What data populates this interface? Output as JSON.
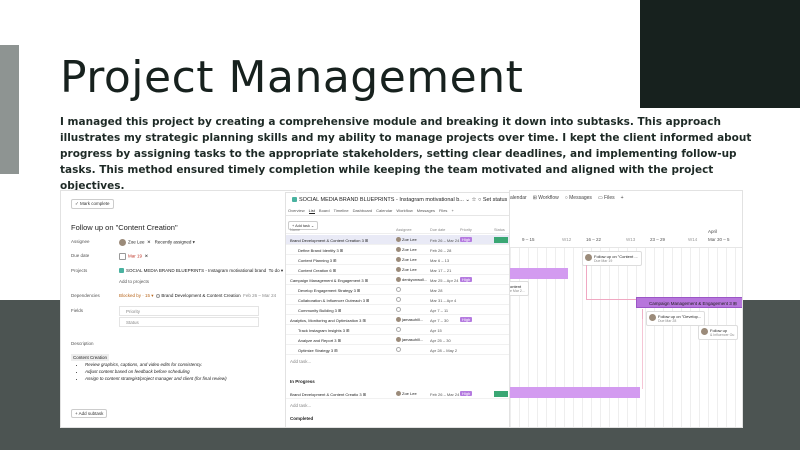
{
  "page": {
    "title": "Project Management",
    "description": "I managed this project by creating a comprehensive module and breaking it down into subtasks. This approach illustrates my strategic planning skills and my ability to manage projects over time. I kept the client informed about progress by assigning tasks to the appropriate stakeholders, setting clear deadlines, and implementing follow-up tasks. This method ensured timely completion while keeping the team motivated and aligned with the project objectives."
  },
  "task_detail": {
    "mark_complete": "✓ Mark complete",
    "title": "Follow up on \"Content Creation\"",
    "assignee_label": "Assignee",
    "assignee": "Zoe Lee",
    "assignee_remove": "✕",
    "assignee_note": "Recently assigned ▾",
    "due_label": "Due date",
    "due": "Mar 19",
    "due_remove": "✕",
    "projects_label": "Projects",
    "project": "SOCIAL MEDIA BRAND BLUEPRINTS - Instagram motivational brand",
    "project_status": "To do ▾",
    "add_projects": "Add to projects",
    "dependencies_label": "Dependencies",
    "blocked_by": "Blocked by · 15 ▾",
    "dependency": "Brand Development & Content Creation",
    "dependency_dates": "Feb 26 – Mar 24",
    "fields_label": "Fields",
    "field_priority": "Priority",
    "field_status": "Status",
    "description_label": "Description",
    "description_tag": "Content Creation",
    "bullets": [
      "Review graphics, captions, and video edits for consistency.",
      "Adjust content based on feedback before scheduling",
      "Assign to content strategist/project manager and client (for final review)"
    ],
    "add_subtask": "+ Add subtask"
  },
  "list_view": {
    "project_title": "SOCIAL MEDIA BRAND BLUEPRINTS - Instagram motivational b... ⌄ ☆ ○ Set status",
    "tabs": [
      "Overview",
      "List",
      "Board",
      "Timeline",
      "Dashboard",
      "Calendar",
      "Workflow",
      "Messages",
      "Files",
      "+"
    ],
    "active_tab": "List",
    "add_task": "+ Add task  ⌄",
    "columns": [
      "Name",
      "Assignee",
      "Due date",
      "Priority",
      "Status"
    ],
    "rows": [
      {
        "name": "Brand Development & Content Creation  3 ⊞",
        "assignee": "Zoe Lee",
        "due": "Feb 26 – Mar 24",
        "priority": "High",
        "status": true,
        "indent": 0,
        "hl": true
      },
      {
        "name": "Define Brand Identity  3 ⊞",
        "assignee": "Zoe Lee",
        "due": "Feb 26 – 28",
        "priority": "",
        "status": false,
        "indent": 1,
        "hl": false
      },
      {
        "name": "Content Planning  3 ⊞",
        "assignee": "Zoe Lee",
        "due": "Mar 6 – 13",
        "priority": "",
        "status": false,
        "indent": 1,
        "hl": false
      },
      {
        "name": "Content Creation  6 ⊞",
        "assignee": "Zoe Lee",
        "due": "Mar 17 – 21",
        "priority": "",
        "status": false,
        "indent": 1,
        "hl": false
      },
      {
        "name": "Campaign Management & Engagement  3 ⊞",
        "assignee": "denkyonwoll...",
        "due": "Mar 25 – Apr 24",
        "priority": "High",
        "status": false,
        "indent": 0,
        "hl": false
      },
      {
        "name": "Develop Engagement Strategy  3 ⊞",
        "assignee": "",
        "due": "Mar 28",
        "priority": "",
        "status": false,
        "indent": 1,
        "hl": false
      },
      {
        "name": "Collaboration & Influencer Outreach  3 ⊞",
        "assignee": "",
        "due": "Mar 31 – Apr 4",
        "priority": "",
        "status": false,
        "indent": 1,
        "hl": false
      },
      {
        "name": "Community Building  3 ⊞",
        "assignee": "",
        "due": "Apr 7 – 11",
        "priority": "",
        "status": false,
        "indent": 1,
        "hl": false
      },
      {
        "name": "Analytics, Monitoring and Optimization  3 ⊞",
        "assignee": "jamasuhill...",
        "due": "Apr 7 – 30",
        "priority": "High",
        "status": false,
        "indent": 0,
        "hl": false
      },
      {
        "name": "Track Instagram Insights  3 ⊞",
        "assignee": "",
        "due": "Apr 15",
        "priority": "",
        "status": false,
        "indent": 1,
        "hl": false
      },
      {
        "name": "Analyze and Report  3 ⊞",
        "assignee": "jamasuhill...",
        "due": "Apr 25 – 30",
        "priority": "",
        "status": false,
        "indent": 1,
        "hl": false
      },
      {
        "name": "Optimize Strategy  3 ⊞",
        "assignee": "",
        "due": "Apr 28 – May 2",
        "priority": "",
        "status": false,
        "indent": 1,
        "hl": false
      }
    ],
    "add_task_link": "Add task...",
    "in_progress_label": "In Progress",
    "in_progress_row": {
      "name": "Brand Development & Content Creatio  3 ⊞",
      "assignee": "Zoe Lee",
      "due": "Feb 26 – Mar 24",
      "priority": "High"
    },
    "add_task_link2": "Add task...",
    "completed_label": "Completed"
  },
  "timeline": {
    "tabs": [
      "alendar",
      "⊞ Workflow",
      "○ Messages",
      "▭ Files",
      "+"
    ],
    "month": "April",
    "weeks": [
      "9 – 15",
      "W12",
      "16 – 22",
      "W13",
      "23 – 29",
      "W14",
      "Mar 30 – 5"
    ],
    "cards": [
      {
        "title": "Follow up on \"Content ...",
        "due": "Due Mar 19"
      },
      {
        "title": "Follow up on \"Develop...",
        "due": "Due Mar 28"
      },
      {
        "title": "Follow up on \"Collab...",
        "due": "& Influencer Ou..."
      },
      {
        "title": "Follow up",
        "due": "& Influencer Ou"
      }
    ],
    "campaign_bar": "Campaign Management & Engagement  3 ⊞",
    "truncated_text": "ontent",
    "truncated_text2": "e Mar 2..."
  },
  "colors": {
    "dark": "#17211e",
    "band": "#4c5452",
    "accent_grey": "#8e9492",
    "high_priority": "#b57be0",
    "timeline_bar": "#d39bf0",
    "status_green": "#3aa774"
  }
}
